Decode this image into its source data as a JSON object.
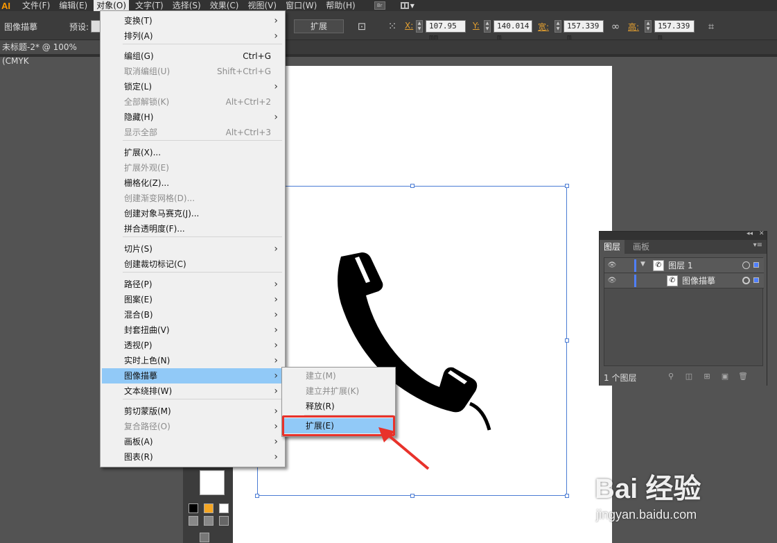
{
  "menubar": {
    "logo": "AI",
    "items": [
      "文件(F)",
      "编辑(E)",
      "对象(O)",
      "文字(T)",
      "选择(S)",
      "效果(C)",
      "视图(V)",
      "窗口(W)",
      "帮助(H)"
    ],
    "bridge_label": "Br"
  },
  "control_bar": {
    "tool_name": "图像描摹",
    "preset_label": "预设:",
    "expand_button": "扩展",
    "x_label": "X:",
    "x_value": "107.95 mm",
    "y_label": "Y:",
    "y_value": "140.014 m",
    "w_label": "宽:",
    "w_value": "157.339 m",
    "h_label": "高:",
    "h_value": "157.339 m"
  },
  "document_tab": {
    "title": "未标题-2* @ 100% (CMYK"
  },
  "object_menu": {
    "items": [
      {
        "label": "变换(T)",
        "shortcut": "",
        "submenu": true,
        "disabled": false
      },
      {
        "label": "排列(A)",
        "shortcut": "",
        "submenu": true,
        "disabled": false
      },
      {
        "label": "编组(G)",
        "shortcut": "Ctrl+G",
        "submenu": false,
        "disabled": false
      },
      {
        "label": "取消编组(U)",
        "shortcut": "Shift+Ctrl+G",
        "submenu": false,
        "disabled": true
      },
      {
        "label": "锁定(L)",
        "shortcut": "",
        "submenu": true,
        "disabled": false
      },
      {
        "label": "全部解锁(K)",
        "shortcut": "Alt+Ctrl+2",
        "submenu": false,
        "disabled": true
      },
      {
        "label": "隐藏(H)",
        "shortcut": "",
        "submenu": true,
        "disabled": false
      },
      {
        "label": "显示全部",
        "shortcut": "Alt+Ctrl+3",
        "submenu": false,
        "disabled": true
      },
      {
        "label": "扩展(X)...",
        "shortcut": "",
        "submenu": false,
        "disabled": false
      },
      {
        "label": "扩展外观(E)",
        "shortcut": "",
        "submenu": false,
        "disabled": true
      },
      {
        "label": "栅格化(Z)...",
        "shortcut": "",
        "submenu": false,
        "disabled": false
      },
      {
        "label": "创建渐变网格(D)...",
        "shortcut": "",
        "submenu": false,
        "disabled": true
      },
      {
        "label": "创建对象马赛克(J)...",
        "shortcut": "",
        "submenu": false,
        "disabled": false
      },
      {
        "label": "拼合透明度(F)...",
        "shortcut": "",
        "submenu": false,
        "disabled": false
      },
      {
        "label": "切片(S)",
        "shortcut": "",
        "submenu": true,
        "disabled": false
      },
      {
        "label": "创建裁切标记(C)",
        "shortcut": "",
        "submenu": false,
        "disabled": false
      },
      {
        "label": "路径(P)",
        "shortcut": "",
        "submenu": true,
        "disabled": false
      },
      {
        "label": "图案(E)",
        "shortcut": "",
        "submenu": true,
        "disabled": false
      },
      {
        "label": "混合(B)",
        "shortcut": "",
        "submenu": true,
        "disabled": false
      },
      {
        "label": "封套扭曲(V)",
        "shortcut": "",
        "submenu": true,
        "disabled": false
      },
      {
        "label": "透视(P)",
        "shortcut": "",
        "submenu": true,
        "disabled": false
      },
      {
        "label": "实时上色(N)",
        "shortcut": "",
        "submenu": true,
        "disabled": false
      },
      {
        "label": "图像描摹",
        "shortcut": "",
        "submenu": true,
        "disabled": false,
        "highlighted": true
      },
      {
        "label": "文本绕排(W)",
        "shortcut": "",
        "submenu": true,
        "disabled": false
      },
      {
        "label": "剪切蒙版(M)",
        "shortcut": "",
        "submenu": true,
        "disabled": false
      },
      {
        "label": "复合路径(O)",
        "shortcut": "",
        "submenu": true,
        "disabled": true
      },
      {
        "label": "画板(A)",
        "shortcut": "",
        "submenu": true,
        "disabled": false
      },
      {
        "label": "图表(R)",
        "shortcut": "",
        "submenu": true,
        "disabled": false
      }
    ]
  },
  "trace_submenu": {
    "items": [
      {
        "label": "建立(M)",
        "disabled": true
      },
      {
        "label": "建立并扩展(K)",
        "disabled": true
      },
      {
        "label": "释放(R)",
        "disabled": false
      },
      {
        "label": "扩展(E)",
        "disabled": false,
        "highlighted": true
      }
    ]
  },
  "layers_panel": {
    "tabs": [
      "图层",
      "画板"
    ],
    "rows": [
      {
        "name": "图层 1"
      },
      {
        "name": "图像描摹"
      }
    ],
    "footer_count": "1 个图层"
  },
  "watermark": {
    "brand": "Bai  经验",
    "url": "jingyan.baidu.com"
  },
  "colors": {
    "highlight": "#91c9f7",
    "annotation_red": "#e8322b",
    "accent_orange": "#ff9a00",
    "layer_blue": "#4f7fff"
  }
}
